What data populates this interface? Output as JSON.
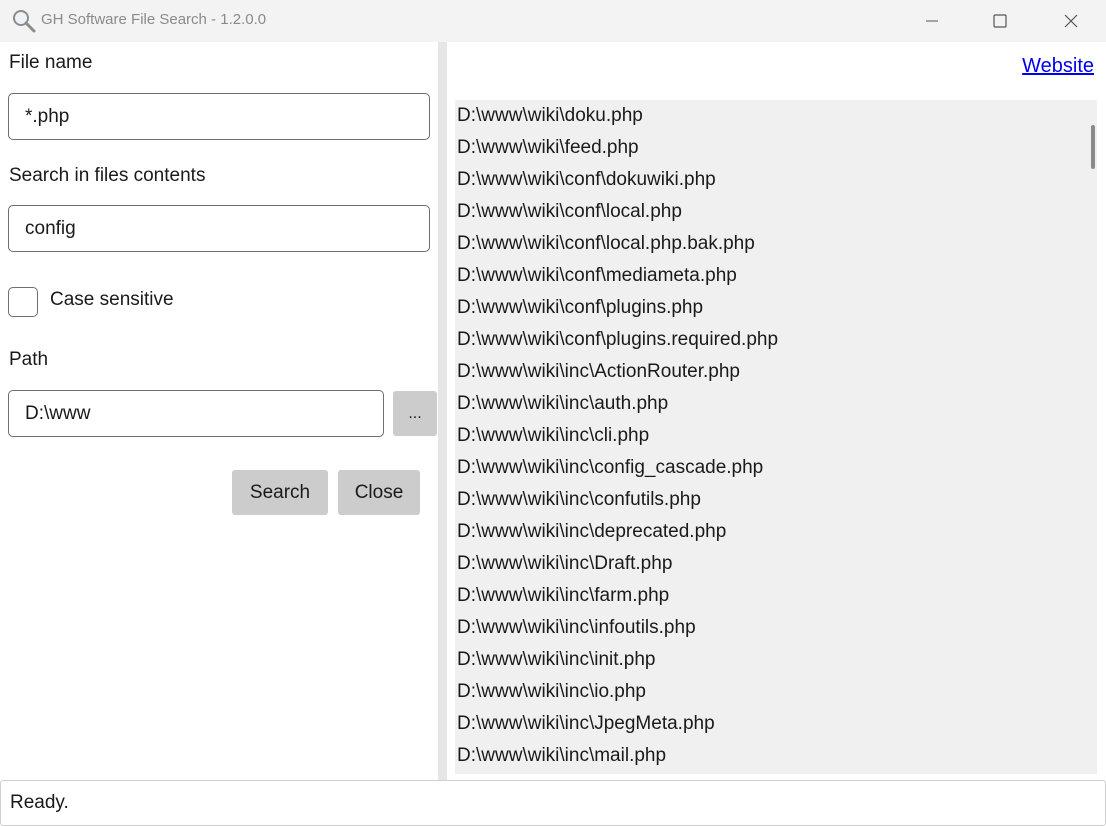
{
  "window": {
    "title": "GH Software File Search - 1.2.0.0",
    "icon": "magnifier-icon"
  },
  "form": {
    "file_name_label": "File name",
    "file_name_value": "*.php",
    "contents_label": "Search in files contents",
    "contents_value": "config",
    "case_sensitive_label": "Case sensitive",
    "case_sensitive_checked": false,
    "path_label": "Path",
    "path_value": "D:\\www",
    "browse_label": "...",
    "search_label": "Search",
    "close_label": "Close"
  },
  "right": {
    "website_label": "Website"
  },
  "results": [
    "D:\\www\\wiki\\doku.php",
    "D:\\www\\wiki\\feed.php",
    "D:\\www\\wiki\\conf\\dokuwiki.php",
    "D:\\www\\wiki\\conf\\local.php",
    "D:\\www\\wiki\\conf\\local.php.bak.php",
    "D:\\www\\wiki\\conf\\mediameta.php",
    "D:\\www\\wiki\\conf\\plugins.php",
    "D:\\www\\wiki\\conf\\plugins.required.php",
    "D:\\www\\wiki\\inc\\ActionRouter.php",
    "D:\\www\\wiki\\inc\\auth.php",
    "D:\\www\\wiki\\inc\\cli.php",
    "D:\\www\\wiki\\inc\\config_cascade.php",
    "D:\\www\\wiki\\inc\\confutils.php",
    "D:\\www\\wiki\\inc\\deprecated.php",
    "D:\\www\\wiki\\inc\\Draft.php",
    "D:\\www\\wiki\\inc\\farm.php",
    "D:\\www\\wiki\\inc\\infoutils.php",
    "D:\\www\\wiki\\inc\\init.php",
    "D:\\www\\wiki\\inc\\io.php",
    "D:\\www\\wiki\\inc\\JpegMeta.php",
    "D:\\www\\wiki\\inc\\mail.php"
  ],
  "status": {
    "text": "Ready."
  }
}
